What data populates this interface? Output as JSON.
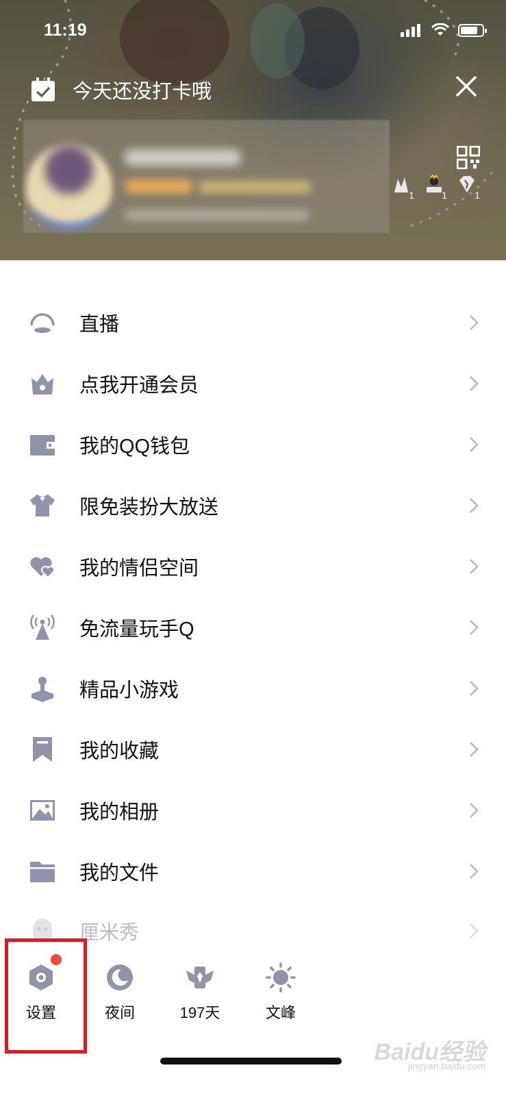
{
  "status": {
    "time": "11:19"
  },
  "header": {
    "checkin_text": "今天还没打卡哦"
  },
  "profile": {
    "medal_count_1": "1",
    "medal_count_2": "1",
    "medal_count_3": "1"
  },
  "menu": {
    "items": [
      {
        "label": "直播",
        "icon": "live-icon"
      },
      {
        "label": "点我开通会员",
        "icon": "crown-icon"
      },
      {
        "label": "我的QQ钱包",
        "icon": "wallet-icon"
      },
      {
        "label": "限免装扮大放送",
        "icon": "shirt-icon"
      },
      {
        "label": "我的情侣空间",
        "icon": "hearts-icon"
      },
      {
        "label": "免流量玩手Q",
        "icon": "signal-tower-icon"
      },
      {
        "label": "精品小游戏",
        "icon": "joystick-icon"
      },
      {
        "label": "我的收藏",
        "icon": "bookmark-icon"
      },
      {
        "label": "我的相册",
        "icon": "photo-icon"
      },
      {
        "label": "我的文件",
        "icon": "folder-icon"
      },
      {
        "label": "厘米秀",
        "icon": "ghost-icon"
      }
    ]
  },
  "bottom_bar": {
    "settings_label": "设置",
    "night_label": "夜间",
    "days_label": "197天",
    "weather_label": "文峰"
  },
  "watermark": {
    "text": "Baidu经验",
    "sub": "jingyan.baidu.com"
  },
  "colors": {
    "icon": "#8f94ab",
    "highlight": "#e5171e",
    "badge": "#f04b3a"
  }
}
